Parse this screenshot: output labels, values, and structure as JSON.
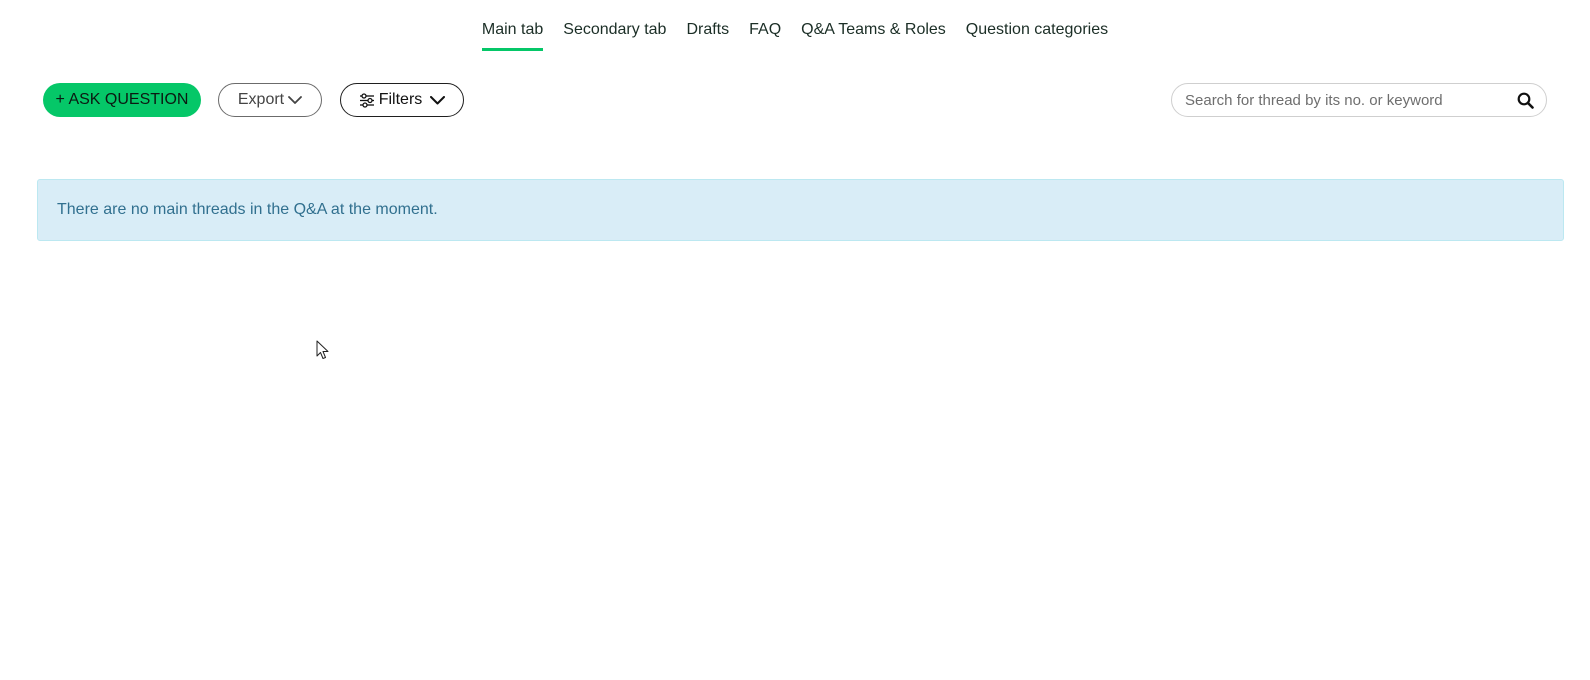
{
  "colors": {
    "accent": "#05c768",
    "alert_bg": "#d9edf7",
    "alert_border": "#bce8f1",
    "alert_text": "#31708f"
  },
  "tabs": [
    {
      "label": "Main tab",
      "active": true
    },
    {
      "label": "Secondary tab",
      "active": false
    },
    {
      "label": "Drafts",
      "active": false
    },
    {
      "label": "FAQ",
      "active": false
    },
    {
      "label": "Q&A Teams & Roles",
      "active": false
    },
    {
      "label": "Question categories",
      "active": false
    }
  ],
  "toolbar": {
    "ask_label": "+ ASK QUESTION",
    "export_label": "Export",
    "filters_label": "Filters",
    "export_icon": "chevron-down-icon",
    "filters_icon": "sliders-icon"
  },
  "search": {
    "placeholder": "Search for thread by its no. or keyword",
    "value": "",
    "icon": "search-icon"
  },
  "alert": {
    "message": "There are no main threads in the Q&A at the moment."
  }
}
